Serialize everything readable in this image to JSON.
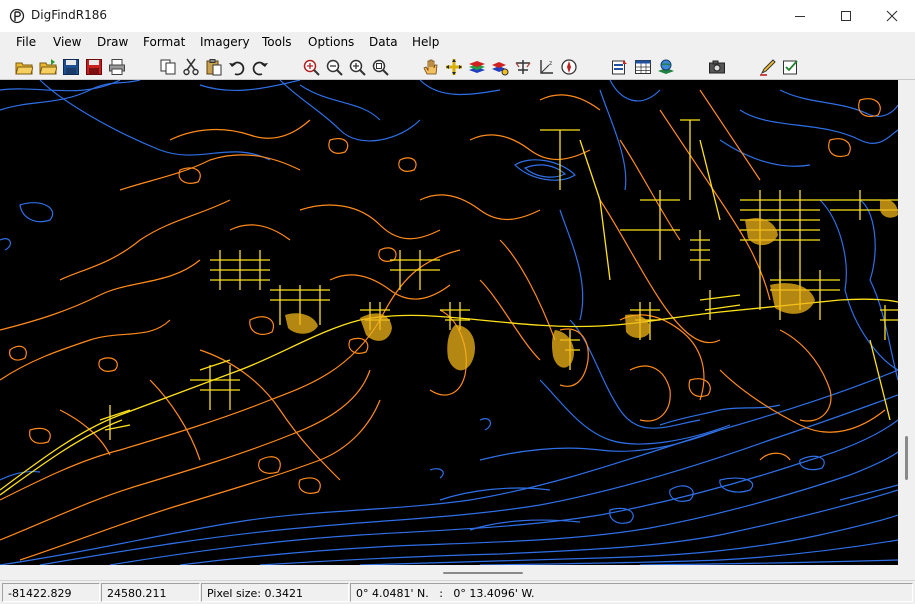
{
  "window": {
    "title": "DigFindR186"
  },
  "menu": [
    "File",
    "View",
    "Draw",
    "Format",
    "Imagery",
    "Tools",
    "Options",
    "Data",
    "Help"
  ],
  "toolbar": [
    {
      "icon": "open-folder-icon"
    },
    {
      "icon": "open-project-icon"
    },
    {
      "icon": "save-icon"
    },
    {
      "icon": "save-as-icon"
    },
    {
      "icon": "print-icon"
    },
    {
      "icon": "copy-icon"
    },
    {
      "icon": "cut-icon"
    },
    {
      "icon": "paste-icon"
    },
    {
      "icon": "undo-icon"
    },
    {
      "icon": "redo-icon"
    },
    {
      "icon": "zoom-extent-icon"
    },
    {
      "icon": "zoom-out-icon"
    },
    {
      "icon": "zoom-in-icon"
    },
    {
      "icon": "zoom-window-icon"
    },
    {
      "icon": "pan-hand-icon"
    },
    {
      "icon": "crosshair-move-icon"
    },
    {
      "icon": "layers-icon"
    },
    {
      "icon": "layer-properties-icon"
    },
    {
      "icon": "measure-icon"
    },
    {
      "icon": "coordinate-axis-icon"
    },
    {
      "icon": "compass-icon"
    },
    {
      "icon": "properties-icon"
    },
    {
      "icon": "table-icon"
    },
    {
      "icon": "globe-layers-icon"
    },
    {
      "icon": "camera-icon"
    },
    {
      "icon": "edit-pencil-icon"
    },
    {
      "icon": "checklist-icon"
    }
  ],
  "colors": {
    "contour_water": "#2f6fe6",
    "contour_land": "#ff8a1c",
    "roads": "#ffe21a",
    "map_background": "#000000"
  },
  "status": {
    "x": "-81422.829",
    "y": "24580.211",
    "pixel_size": "Pixel size: 0.3421",
    "latlon": "0° 4.0481' N.   :   0° 13.4096' W."
  }
}
